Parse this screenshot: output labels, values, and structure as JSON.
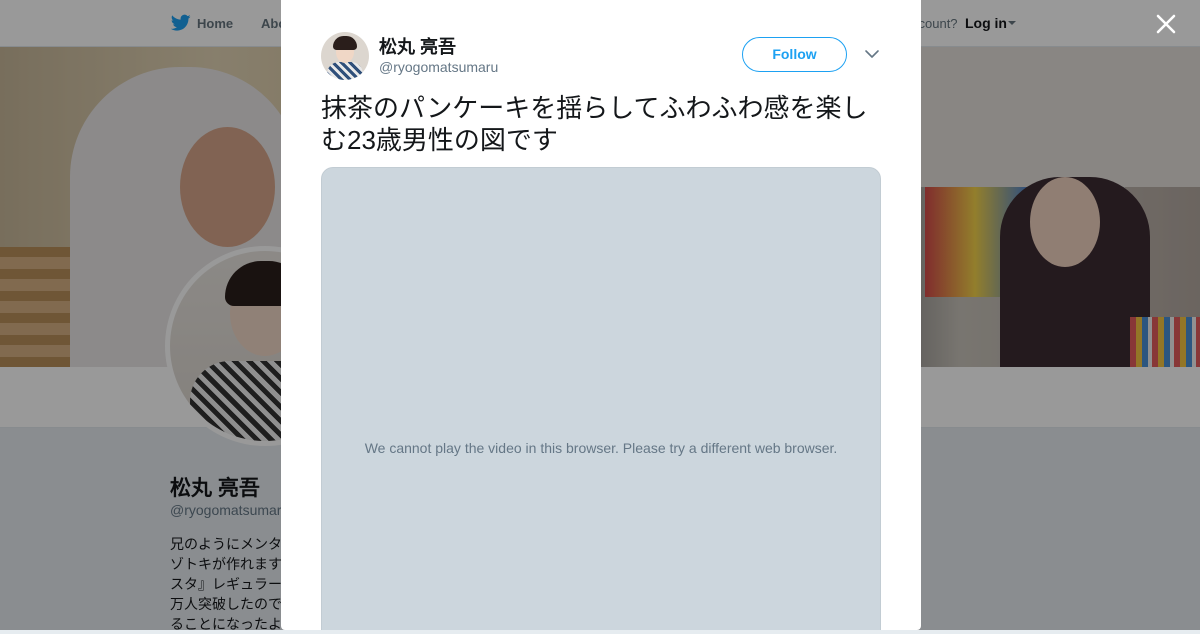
{
  "topbar": {
    "home_label": "Home",
    "about_label": "Abo",
    "account_prompt": "ccount?",
    "login_label": "Log in"
  },
  "profile": {
    "name": "松丸 亮吾",
    "handle": "@ryogomatsumaru",
    "bio_lines": [
      "兄のようにメンタ",
      "ゾトキが作れます",
      "スタ』レギュラー",
      "万人突破したので",
      "ることになったよ"
    ]
  },
  "modal": {
    "author_name": "松丸 亮吾",
    "author_handle": "@ryogomatsumaru",
    "follow_label": "Follow",
    "tweet_text": "抹茶のパンケーキを揺らしてふわふわ感を楽しむ23歳男性の図です",
    "video_message": "We cannot play the video in this browser. Please try a different web browser."
  },
  "colors": {
    "accent": "#1da1f2",
    "text_primary": "#14171a",
    "text_secondary": "#657786",
    "media_bg": "#ccd6dd"
  },
  "icons": {
    "brand": "twitter-bird-icon",
    "close": "close-icon",
    "menu": "chevron-down-icon"
  }
}
